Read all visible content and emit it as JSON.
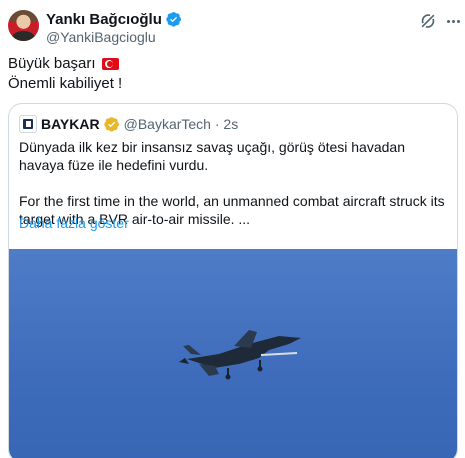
{
  "author": {
    "name": "Yankı Bağcıoğlu",
    "handle": "@YankiBagcioglu"
  },
  "tweet": {
    "line1": "Büyük başarı",
    "line2": "Önemli kabiliyet !"
  },
  "icons": {
    "verified": "verified-badge-icon",
    "flag": "turkey-flag-icon",
    "grok": "grok-icon",
    "more": "more-icon"
  },
  "quote": {
    "name": "BAYKAR",
    "handle": "@BaykarTech · 2s",
    "text_tr": "Dünyada ilk kez bir insansız savaş uçağı, görüş ötesi havadan havaya füze ile hedefini vurdu.",
    "text_en": "For the first time in the world, an unmanned combat aircraft struck its target with a BVR air-to-air missile. ...",
    "show_more": "Daha fazla göster"
  },
  "colors": {
    "verified_blue": "#1d9bf0",
    "verified_gold": "#e8b829",
    "link": "#1d9bf0",
    "sky": "#4573c1"
  }
}
